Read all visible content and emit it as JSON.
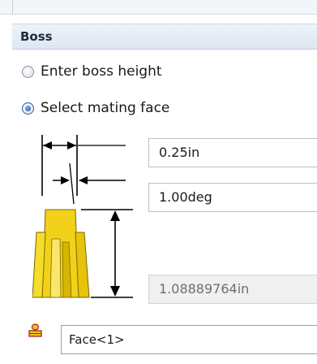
{
  "panel": {
    "title": "Boss",
    "options": [
      {
        "label": "Enter boss height",
        "selected": false
      },
      {
        "label": "Select mating face",
        "selected": true
      }
    ],
    "fields": {
      "thickness": "0.25in",
      "draft_angle": "1.00deg",
      "height": "1.08889764in"
    },
    "face_selection": "Face<1>"
  },
  "icons": [
    "boss-diagram-icon",
    "face-selection-icon"
  ],
  "colors": {
    "boss_yellow": "#f2d11a",
    "header_bg": "#e4ebf5",
    "selected_radio": "#1a4fa0"
  }
}
